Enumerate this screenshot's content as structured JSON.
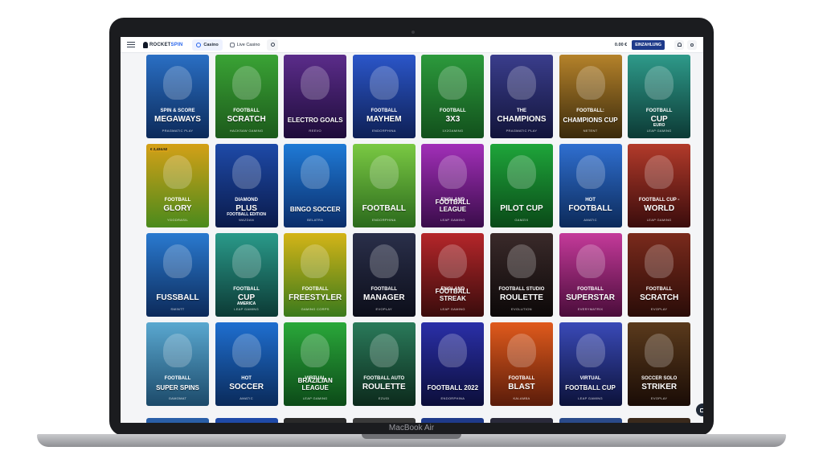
{
  "device": {
    "model": "MacBook Air"
  },
  "topbar": {
    "logo_a": "ROCKET",
    "logo_b": "SPIN",
    "tabs": [
      {
        "label": "Casino"
      },
      {
        "label": "Live Casino"
      }
    ],
    "balance": "0.00 €",
    "deposit_label": "EINZAHLUNG"
  },
  "colors": {
    "accent": "#2563eb",
    "deposit": "#1e3a8a"
  },
  "games": [
    {
      "t1": "SPIN & SCORE",
      "t2": "MEGAWAYS",
      "t3": "PRAGMATIC PLAY",
      "bg": "#2a6fc4",
      "bg2": "#0c2a5a"
    },
    {
      "t1": "FOOTBALL",
      "t2": "SCRATCH",
      "t3": "HACKSAW GAMING",
      "bg": "#3aa335",
      "bg2": "#1c5a1b"
    },
    {
      "t1": "",
      "t2": "ELECTRO GOALS",
      "t3": "REEVO",
      "bg": "#5b2c8a",
      "bg2": "#1e0c3a"
    },
    {
      "t1": "FOOTBALL",
      "t2": "MAYHEM",
      "t3": "ENDORPHINA",
      "bg": "#2b56c9",
      "bg2": "#0e2056"
    },
    {
      "t1": "FOOTBALL",
      "t2": "3X3",
      "t3": "1X2GAMING",
      "bg": "#2c9a3c",
      "bg2": "#12501c"
    },
    {
      "t1": "THE",
      "t2": "CHAMPIONS",
      "t3": "PRAGMATIC PLAY",
      "bg": "#3a3d8c",
      "bg2": "#12143a"
    },
    {
      "t1": "FOOTBALL:",
      "t2": "CHAMPIONS CUP",
      "t3": "NETENT",
      "bg": "#b5822a",
      "bg2": "#3a2a0c"
    },
    {
      "t1": "FOOTBALL",
      "t2": "CUP",
      "t3": "LEAP GAMING",
      "t4": "EURO",
      "bg": "#2e9a8a",
      "bg2": "#0c3a35"
    },
    {
      "t1": "FOOTBALL",
      "t2": "GLORY",
      "t3": "YGGDRASIL",
      "bg": "#d4a017",
      "bg2": "#4a8a1c",
      "badge": "€ 2,434.52"
    },
    {
      "t1": "DIAMOND",
      "t2": "PLUS",
      "t3": "WAZDAN",
      "t4": "FOOTBALL EDITION",
      "bg": "#1e4aa8",
      "bg2": "#0a1a4a"
    },
    {
      "t1": "",
      "t2": "BINGO SOCCER",
      "t3": "BELATRA",
      "bg": "#1f7ad6",
      "bg2": "#0a2d6a"
    },
    {
      "t1": "",
      "t2": "FOOTBALL",
      "t3": "ENDORPHINA",
      "bg": "#7ac943",
      "bg2": "#2b6a1c"
    },
    {
      "t1": "ENGLAND",
      "t2": "FOOTBALL LEAGUE",
      "t3": "LEAP GAMING",
      "bg": "#a22fb8",
      "bg2": "#3a0c4a"
    },
    {
      "t1": "",
      "t2": "PILOT CUP",
      "t3": "GAMZIX",
      "bg": "#1ea53a",
      "bg2": "#0a4a18"
    },
    {
      "t1": "HOT",
      "t2": "FOOTBALL",
      "t3": "AMATIC",
      "bg": "#2f6fd0",
      "bg2": "#0c2a5a"
    },
    {
      "t1": "FOOTBALL CUP -",
      "t2": "WORLD",
      "t3": "LEAP GAMING",
      "bg": "#b23a2a",
      "bg2": "#3a0c0c"
    },
    {
      "t1": "",
      "t2": "FUSSBALL",
      "t3": "SWINTT",
      "bg": "#2a7ad0",
      "bg2": "#0c2a5a"
    },
    {
      "t1": "FOOTBALL",
      "t2": "CUP",
      "t3": "LEAP GAMING",
      "t4": "AMERICA",
      "bg": "#2a9a8a",
      "bg2": "#0c3a35"
    },
    {
      "t1": "FOOTBALL",
      "t2": "FREESTYLER",
      "t3": "GAMING CORPS",
      "bg": "#d4b417",
      "bg2": "#3a7a1c"
    },
    {
      "t1": "FOOTBALL",
      "t2": "MANAGER",
      "t3": "EVOPLAY",
      "bg": "#2a2f4a",
      "bg2": "#0c0e1a"
    },
    {
      "t1": "ENGLAND",
      "t2": "FOOTBALL STREAK",
      "t3": "LEAP GAMING",
      "bg": "#b5262a",
      "bg2": "#3a0c0c"
    },
    {
      "t1": "FOOTBALL STUDIO",
      "t2": "ROULETTE",
      "t3": "EVOLUTION",
      "bg": "#3a2a2a",
      "bg2": "#0c0808"
    },
    {
      "t1": "FOOTBALL",
      "t2": "SUPERSTAR",
      "t3": "EVERYMATRIX",
      "bg": "#c43a9a",
      "bg2": "#4a0c3a"
    },
    {
      "t1": "FOOTBALL",
      "t2": "SCRATCH",
      "t3": "EVOPLAY",
      "bg": "#7a2a1c",
      "bg2": "#2a0c08"
    },
    {
      "t1": "FOOTBALL",
      "t2": "SUPER SPINS",
      "t3": "GAMOMAT",
      "bg": "#5aa8d0",
      "bg2": "#1c4a6a"
    },
    {
      "t1": "HOT",
      "t2": "SOCCER",
      "t3": "AMATIC",
      "bg": "#1f6fd0",
      "bg2": "#0a2a5a"
    },
    {
      "t1": "VIRTUAL",
      "t2": "BRAZILIAN LEAGUE",
      "t3": "LEAP GAMING",
      "bg": "#2aa83a",
      "bg2": "#0c4a18"
    },
    {
      "t1": "FOOTBALL AUTO",
      "t2": "ROULETTE",
      "t3": "EZUGI",
      "bg": "#2a7a5a",
      "bg2": "#0c2a1c"
    },
    {
      "t1": "",
      "t2": "FOOTBALL 2022",
      "t3": "ENDORPHINA",
      "bg": "#2a2fa8",
      "bg2": "#0c0e3a"
    },
    {
      "t1": "FOOTBALL",
      "t2": "BLAST",
      "t3": "KALAMBA",
      "bg": "#e05a1c",
      "bg2": "#5a1c0a"
    },
    {
      "t1": "VIRTUAL",
      "t2": "FOOTBALL CUP",
      "t3": "LEAP GAMING",
      "bg": "#3a4ab8",
      "bg2": "#0c123a"
    },
    {
      "t1": "SOCCER SOLO",
      "t2": "STRIKER",
      "t3": "EVOPLAY",
      "bg": "#5a3a1c",
      "bg2": "#1a0c06"
    }
  ]
}
